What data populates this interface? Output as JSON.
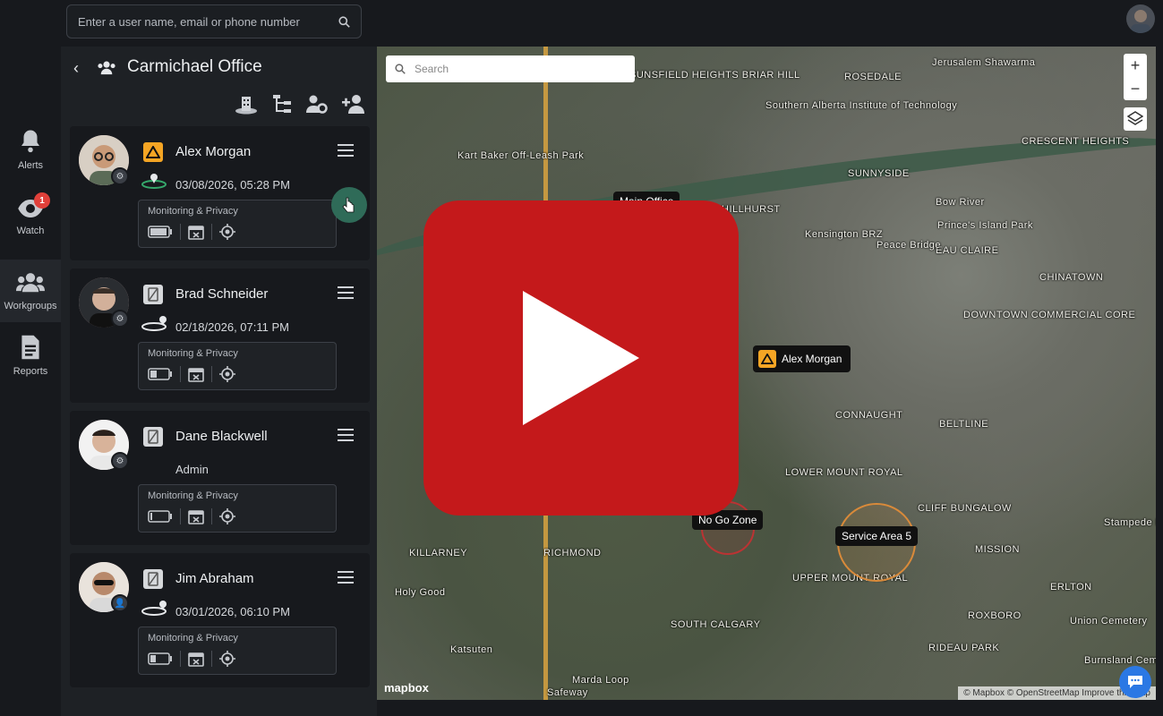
{
  "search": {
    "placeholder": "Enter a user name, email or phone number"
  },
  "nav": [
    {
      "label": "Alerts",
      "icon": "bell-icon"
    },
    {
      "label": "Watch",
      "icon": "eye-icon",
      "badge": "1"
    },
    {
      "label": "Workgroups",
      "icon": "users-icon"
    },
    {
      "label": "Reports",
      "icon": "report-icon"
    }
  ],
  "panel": {
    "title": "Carmichael Office",
    "tools": [
      "building-icon",
      "hierarchy-icon",
      "user-gear-icon",
      "add-user-icon"
    ]
  },
  "members": [
    {
      "name": "Alex Morgan",
      "sub": "03/08/2026, 05:28 PM",
      "monitoring": "Monitoring & Privacy",
      "device": "alert-triangle",
      "battery": 0.95
    },
    {
      "name": "Brad Schneider",
      "sub": "02/18/2026, 07:11 PM",
      "monitoring": "Monitoring & Privacy",
      "device": "no-device",
      "battery": 0.35
    },
    {
      "name": "Dane Blackwell",
      "sub": "Admin",
      "monitoring": "Monitoring & Privacy",
      "device": "no-device",
      "battery": 0.1
    },
    {
      "name": "Jim Abraham",
      "sub": "03/01/2026, 06:10 PM",
      "monitoring": "Monitoring & Privacy",
      "device": "no-device",
      "battery": 0.3
    }
  ],
  "map": {
    "search_placeholder": "Search",
    "zoom_in": "+",
    "zoom_out": "−",
    "labels": [
      "ROSEDALE",
      "SUNNYSIDE",
      "CRESCENT HEIGHTS",
      "HILLHURST",
      "EAU CLAIRE",
      "CHINATOWN",
      "DOWNTOWN COMMERCIAL CORE",
      "BELTLINE",
      "CONNAUGHT",
      "LOWER MOUNT ROYAL",
      "CLIFF BUNGALOW",
      "MISSION",
      "RICHMOND",
      "KILLARNEY",
      "UPPER MOUNT ROYAL",
      "SOUTH CALGARY",
      "ERLTON",
      "ROXBORO",
      "RIDEAU PARK",
      "SUNSFIELD HEIGHTS BRIAR HILL",
      "Prince's Island Park",
      "Kart Baker Off-Leash Park",
      "Southern Alberta Institute of Technology",
      "Kensington BRZ",
      "Peace Bridge",
      "Bow River",
      "Jerusalem Shawarma",
      "Union Cemetery",
      "Burnsland Cemetery",
      "Stampede Park",
      "Marda Loop",
      "Safeway",
      "Katsuten",
      "Holy Good"
    ],
    "pins": {
      "main_office": "Main Office",
      "alex": "Alex Morgan",
      "no_go": "No Go Zone",
      "service": "Service Area 5"
    },
    "brand": "mapbox",
    "attribution": "© Mapbox © OpenStreetMap Improve this map"
  },
  "colors": {
    "accent_orange": "#f5a524",
    "play_red": "#c4191b",
    "badge_red": "#e0403a"
  }
}
